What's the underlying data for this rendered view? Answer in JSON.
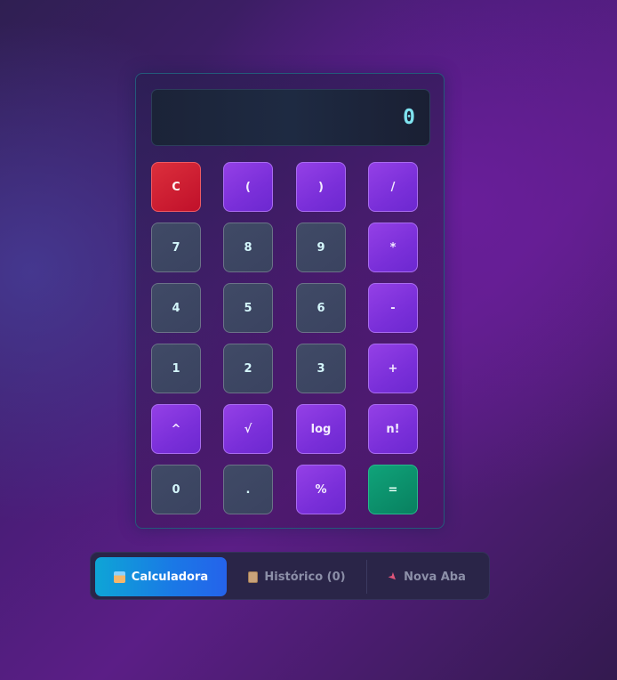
{
  "display": {
    "value": "0"
  },
  "keypad": {
    "clear": "C",
    "open_paren": "(",
    "close_paren": ")",
    "divide": "/",
    "seven": "7",
    "eight": "8",
    "nine": "9",
    "multiply": "*",
    "four": "4",
    "five": "5",
    "six": "6",
    "subtract": "-",
    "one": "1",
    "two": "2",
    "three": "3",
    "add": "+",
    "power": "^",
    "sqrt": "√",
    "log": "log",
    "factorial": "n!",
    "zero": "0",
    "decimal": ".",
    "percent": "%",
    "equals": "="
  },
  "tabs": {
    "calculator": {
      "label": "Calculadora",
      "icon": "calculator-icon"
    },
    "history": {
      "label": "Histórico (0)",
      "icon": "clipboard-icon"
    },
    "new_tab": {
      "label": "Nova Aba",
      "icon": "rocket-icon"
    }
  },
  "colors": {
    "accent_purple": "#7a2fd9",
    "clear_red": "#c0102a",
    "equals_green": "#08805f",
    "display_text": "#7fe3f0",
    "active_tab": "#1a78e6"
  }
}
